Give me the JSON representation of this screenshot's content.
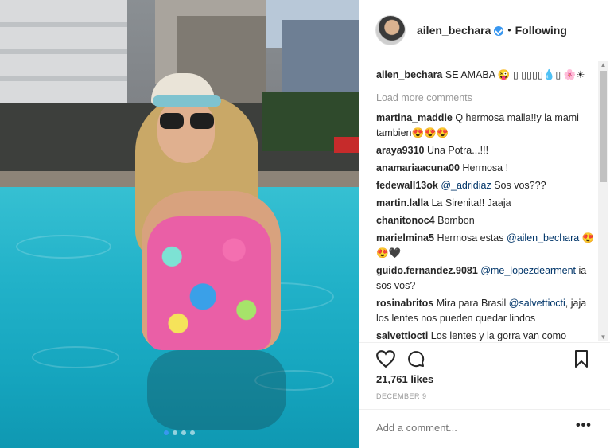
{
  "post": {
    "image_alt": "Woman in floral swimsuit standing in a pool",
    "carousel_count": 4,
    "carousel_active": 1
  },
  "header": {
    "username": "ailen_bechara",
    "verified_icon": "verified-badge-icon",
    "separator": "•",
    "follow_label": "Following"
  },
  "caption": {
    "username": "ailen_bechara",
    "text": "SE AMABA 😜 ▯ ▯▯▯▯💧▯ 🌸☀"
  },
  "load_more": "Load more comments",
  "comments": [
    {
      "user": "martina_maddie",
      "text": "Q hermosa malla!!y la mami tambien😍😍😍"
    },
    {
      "user": "araya9310",
      "text": "Una Potra...!!!"
    },
    {
      "user": "anamariaacuna00",
      "text": "Hermosa !"
    },
    {
      "user": "fedewall13ok",
      "mention": "@_adridiaz",
      "text": "Sos vos???"
    },
    {
      "user": "martin.lalla",
      "text": "La Sirenita!! Jaaja"
    },
    {
      "user": "chanitonoc4",
      "text": "Bombon"
    },
    {
      "user": "marielmina5",
      "text": "Hermosa estas",
      "mention": "@ailen_bechara",
      "text2": "😍😍🖤"
    },
    {
      "user": "guido.fernandez.9081",
      "mention": "@me_lopezdearment",
      "text": "ia sos vos?"
    },
    {
      "user": "rosinabritos",
      "text": "Mira para Brasil",
      "mention": "@salvettiocti",
      "text2": ", jaja los lentes nos pueden quedar lindos"
    },
    {
      "user": "salvettiocti",
      "text": "Los lentes y la gorra van como"
    }
  ],
  "actions": {
    "like_icon": "heart-icon",
    "comment_icon": "comment-bubble-icon",
    "save_icon": "bookmark-icon"
  },
  "likes": "21,761 likes",
  "date": "DECEMBER 9",
  "add_comment": {
    "placeholder": "Add a comment...",
    "more_label": "•••"
  },
  "colors": {
    "link": "#003569",
    "accent": "#3897f0",
    "muted": "#999999"
  }
}
